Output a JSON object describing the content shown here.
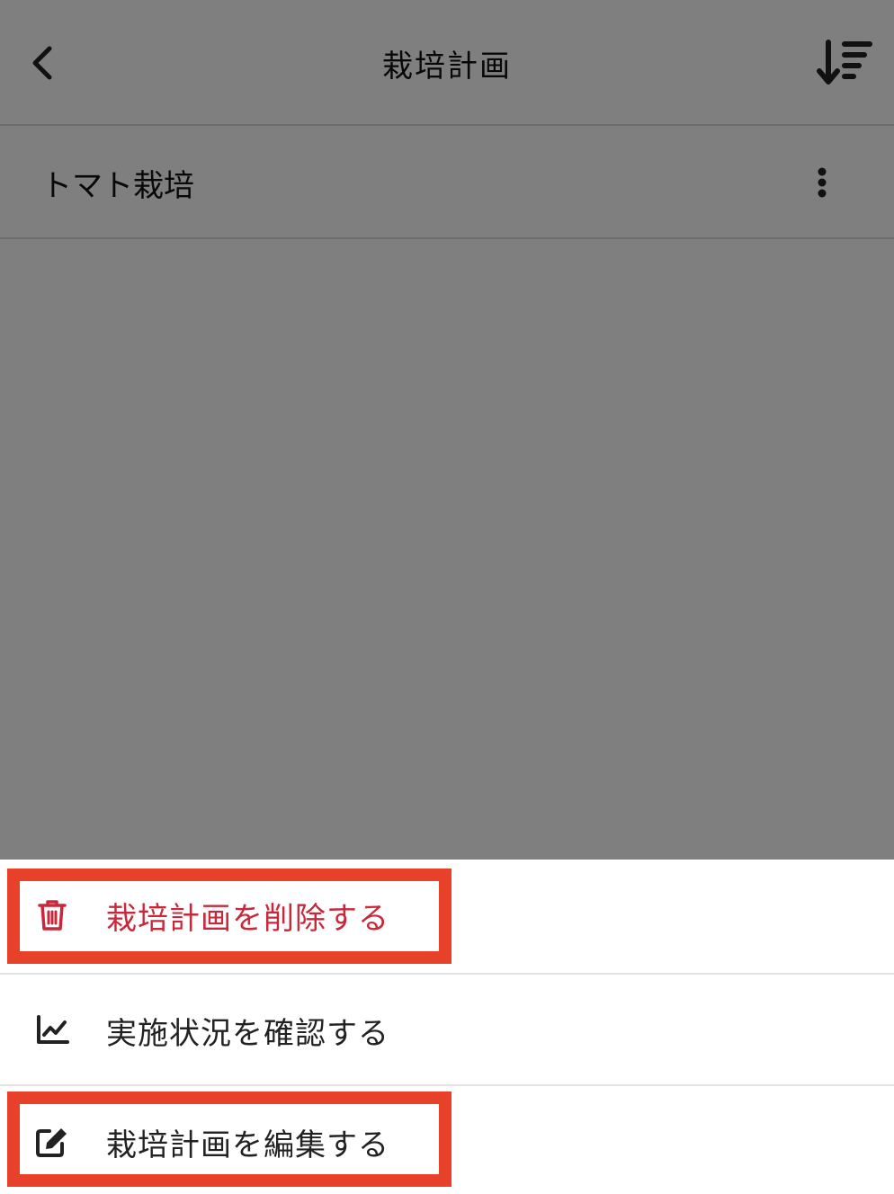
{
  "header": {
    "title": "栽培計画",
    "back_icon": "chevron-left-icon",
    "sort_icon": "sort-descending-icon"
  },
  "list": {
    "items": [
      {
        "label": "トマト栽培",
        "menu_icon": "more-vertical-icon"
      }
    ]
  },
  "action_sheet": {
    "items": [
      {
        "label": "栽培計画を削除する",
        "icon": "trash-icon",
        "color": "#c8283a"
      },
      {
        "label": "実施状況を確認する",
        "icon": "line-chart-icon"
      },
      {
        "label": "栽培計画を編集する",
        "icon": "edit-icon"
      }
    ]
  },
  "colors": {
    "scrim": "rgba(0,0,0,0.5)",
    "danger": "#c8283a",
    "highlight": "#e8412a"
  }
}
